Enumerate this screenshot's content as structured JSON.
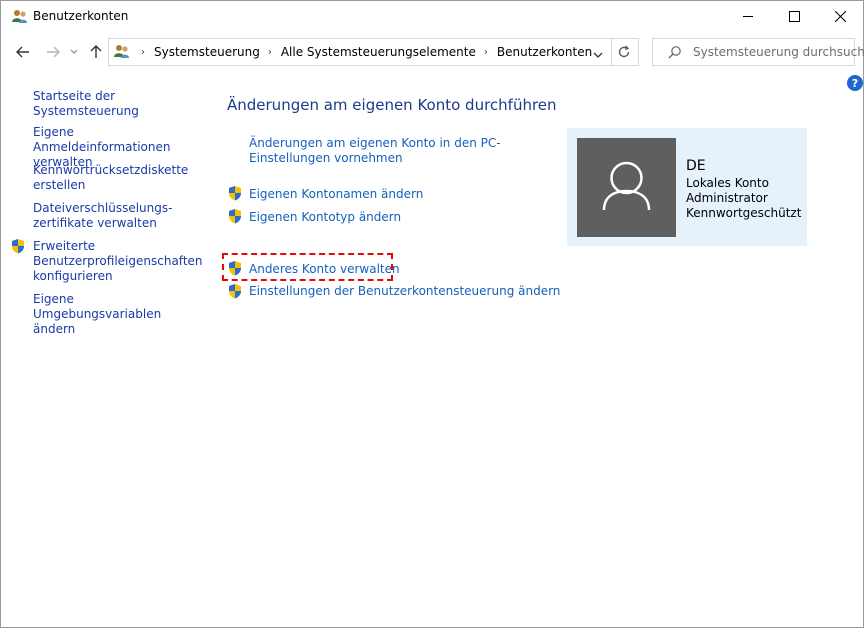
{
  "window": {
    "title": "Benutzerkonten",
    "icon": "user-accounts-icon",
    "controls": [
      "minimize-icon",
      "maximize-icon",
      "close-icon"
    ]
  },
  "navigation": {
    "breadcrumbs": [
      "Systemsteuerung",
      "Alle Systemsteuerungselemente",
      "Benutzerkonten"
    ],
    "search_placeholder": "Systemsteuerung durchsuch..."
  },
  "sidebar": {
    "items": [
      {
        "label": "Startseite der Systemsteuerung",
        "shield": false
      },
      {
        "label": "Eigene Anmeldeinformationen verwalten",
        "shield": false
      },
      {
        "label": "Kennwortrücksetzdiskette erstellen",
        "shield": false
      },
      {
        "label": "Dateiverschlüsselungs-zertifikate verwalten",
        "shield": false
      },
      {
        "label": "Erweiterte Benutzerprofileigenschaften konfigurieren",
        "shield": true
      },
      {
        "label": "Eigene Umgebungsvariablen ändern",
        "shield": false
      }
    ]
  },
  "main": {
    "title": "Änderungen am eigenen Konto durchführen",
    "links": [
      {
        "label": "Änderungen am eigenen Konto in den PC-Einstellungen vornehmen",
        "shield": false
      },
      {
        "label": "Eigenen Kontonamen ändern",
        "shield": true
      },
      {
        "label": "Eigenen Kontotyp ändern",
        "shield": true
      },
      {
        "label": "Anderes Konto verwalten",
        "shield": true,
        "highlighted": true
      },
      {
        "label": "Einstellungen der Benutzerkontensteuerung ändern",
        "shield": true
      }
    ]
  },
  "user": {
    "name": "DE",
    "details": [
      "Lokales Konto",
      "Administrator",
      "Kennwortgeschützt"
    ]
  },
  "colors": {
    "link": "#1560bd",
    "title": "#1e3a8a",
    "highlight": "#e30a0a",
    "user_panel": "#e5f1fb",
    "avatar": "#5f5f5f"
  }
}
